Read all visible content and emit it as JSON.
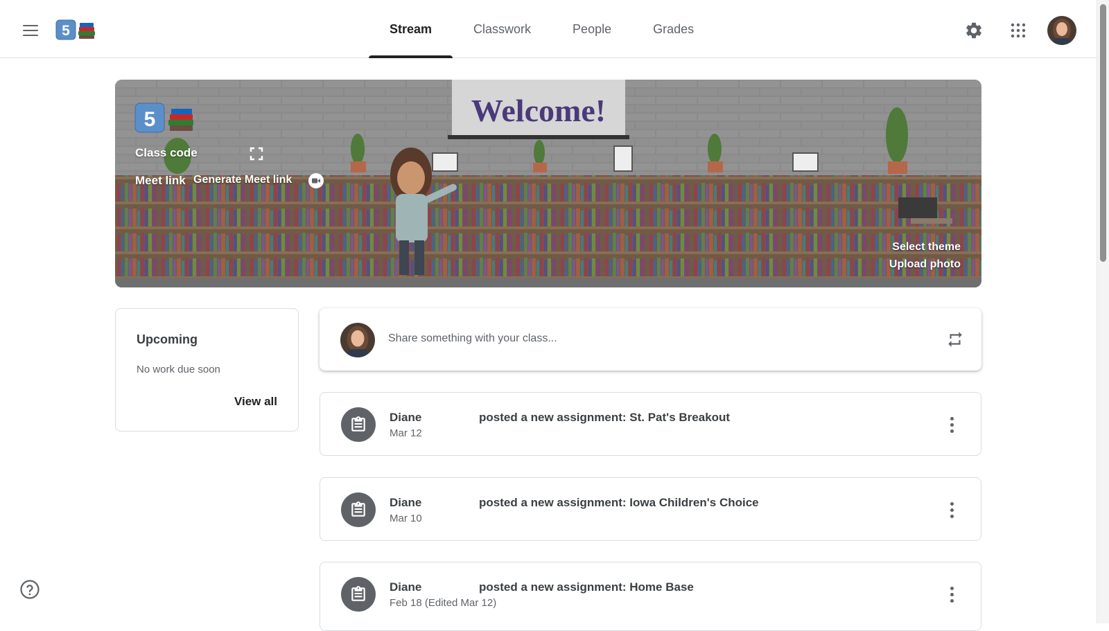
{
  "header": {
    "tabs": [
      {
        "label": "Stream",
        "active": true
      },
      {
        "label": "Classwork",
        "active": false
      },
      {
        "label": "People",
        "active": false
      },
      {
        "label": "Grades",
        "active": false
      }
    ],
    "class_logo_icon": "class-logo-5-books",
    "icons": [
      "menu-icon",
      "settings-icon",
      "apps-grid-icon",
      "user-avatar"
    ]
  },
  "banner": {
    "welcome_text": "Welcome!",
    "logo_number": "5",
    "class_code_label": "Class code",
    "meet_link_label": "Meet link",
    "generate_meet_label": "Generate Meet link",
    "select_theme_label": "Select theme",
    "upload_photo_label": "Upload photo"
  },
  "upcoming": {
    "title": "Upcoming",
    "empty_text": "No work due soon",
    "view_all_label": "View all"
  },
  "share": {
    "placeholder": "Share something with your class..."
  },
  "posts": [
    {
      "author": "Diane",
      "date": "Mar 12",
      "title": "posted a new assignment: St. Pat's Breakout"
    },
    {
      "author": "Diane",
      "date": "Mar 10",
      "title": "posted a new assignment: Iowa Children's Choice"
    },
    {
      "author": "Diane",
      "date": "Feb 18 (Edited Mar 12)",
      "title": "posted a new assignment: Home Base"
    }
  ],
  "colors": {
    "text_primary": "#3c4043",
    "text_secondary": "#5f6368",
    "tab_active": "#202124",
    "border": "#dadce0"
  }
}
